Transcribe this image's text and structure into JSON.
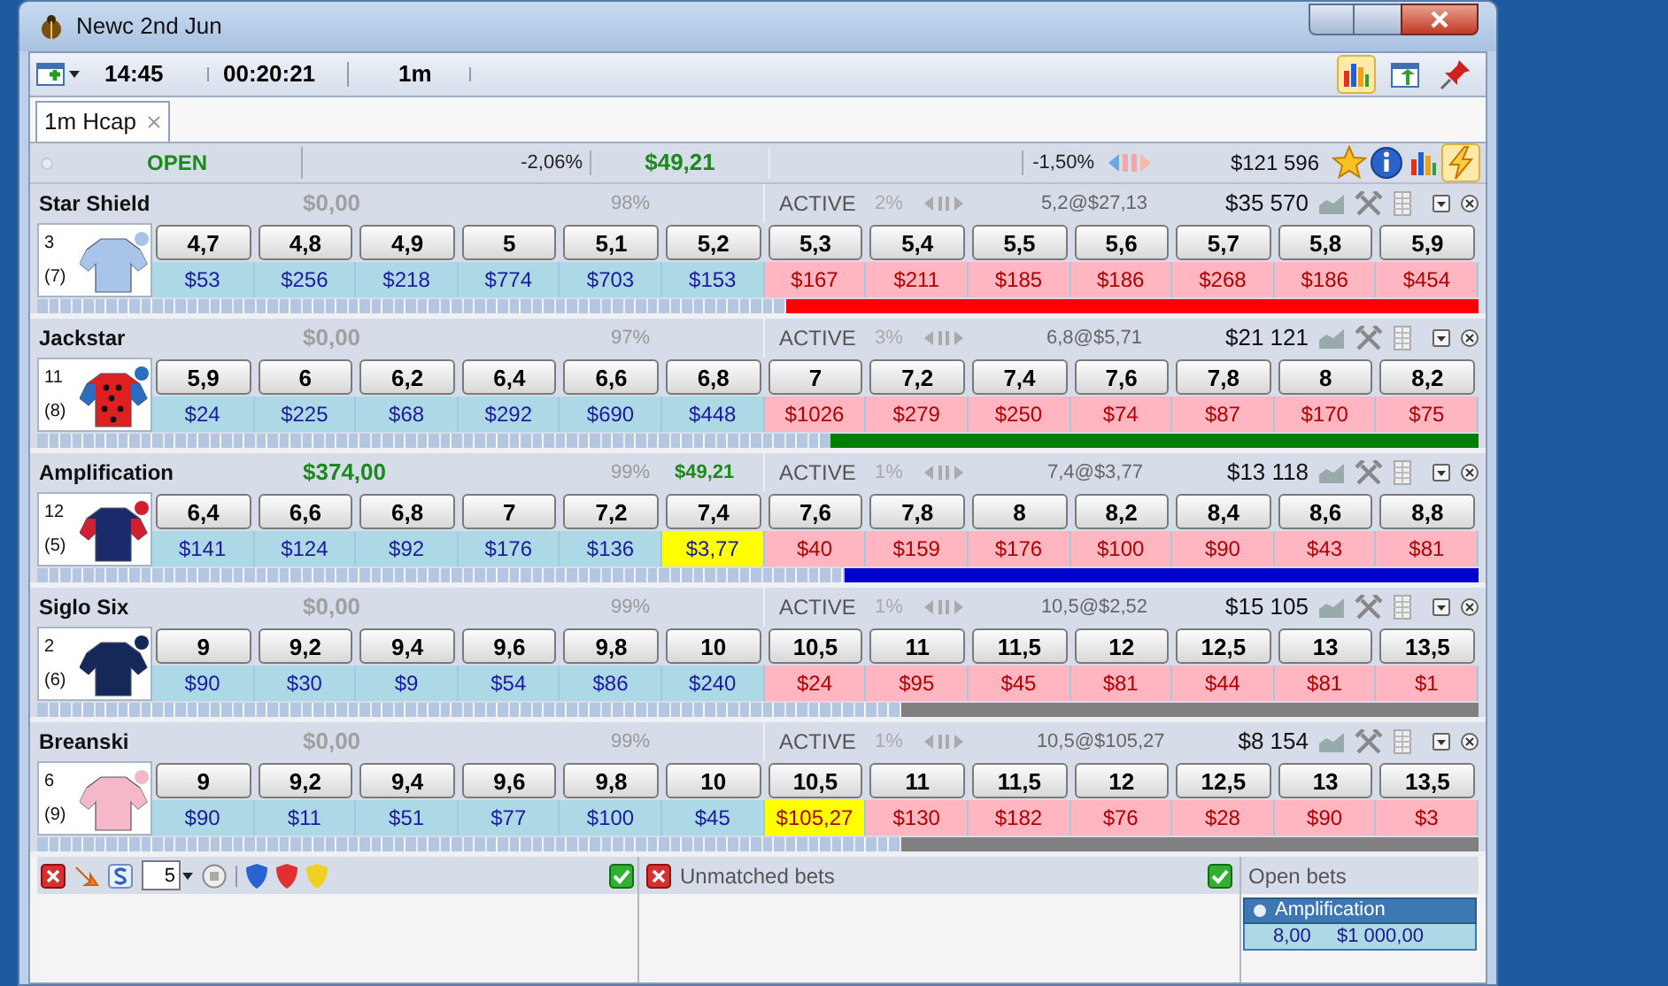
{
  "window": {
    "title": "Newc 2nd Jun"
  },
  "toolbar": {
    "time": "14:45",
    "countdown": "00:20:21",
    "distance": "1m",
    "icons": [
      {
        "kind": "chart",
        "on": true
      },
      {
        "kind": "export",
        "on": false
      },
      {
        "kind": "pin",
        "on": false
      }
    ]
  },
  "tabs": [
    {
      "label": "1m Hcap",
      "selected": true
    }
  ],
  "market": {
    "status": "OPEN",
    "back_percent": "-2,06%",
    "total": "$49,21",
    "lay_percent": "-1,50%",
    "matched": "$121 596",
    "icons": [
      {
        "kind": "star",
        "on": false
      },
      {
        "kind": "info",
        "on": false
      },
      {
        "kind": "chart",
        "on": false
      },
      {
        "kind": "lightning",
        "on": true
      }
    ]
  },
  "runners": [
    {
      "name": "Star Shield",
      "number": "3",
      "draw": "(7)",
      "pl": "$0,00",
      "in_profit": false,
      "percent": "98%",
      "status": "ACTIVE",
      "percent_2": "2%",
      "last_traded": "5,2@$27,13",
      "matched": "$35 570",
      "silk": {
        "color": "#a8c4e8",
        "sleeves": {
          "color": "#a8c4e8"
        },
        "spots": false
      },
      "bar": {
        "level": 0.48,
        "color": "#ff0000"
      },
      "back": [
        {
          "price": "4,7",
          "amount": "$53",
          "highlighted": false
        },
        {
          "price": "4,8",
          "amount": "$256",
          "highlighted": false
        },
        {
          "price": "4,9",
          "amount": "$218",
          "highlighted": false
        },
        {
          "price": "5",
          "amount": "$774",
          "highlighted": false
        },
        {
          "price": "5,1",
          "amount": "$703",
          "highlighted": false
        },
        {
          "price": "5,2",
          "amount": "$153",
          "highlighted": false
        }
      ],
      "lay": [
        {
          "price": "5,3",
          "amount": "$167",
          "highlighted": false
        },
        {
          "price": "5,4",
          "amount": "$211",
          "highlighted": false
        },
        {
          "price": "5,5",
          "amount": "$185",
          "highlighted": false
        },
        {
          "price": "5,6",
          "amount": "$186",
          "highlighted": false
        },
        {
          "price": "5,7",
          "amount": "$268",
          "highlighted": false
        },
        {
          "price": "5,8",
          "amount": "$186",
          "highlighted": false
        },
        {
          "price": "5,9",
          "amount": "$454",
          "highlighted": false
        }
      ]
    },
    {
      "name": "Jackstar",
      "number": "11",
      "draw": "(8)",
      "pl": "$0,00",
      "in_profit": false,
      "percent": "97%",
      "status": "ACTIVE",
      "percent_2": "3%",
      "last_traded": "6,8@$5,71",
      "matched": "$21 121",
      "silk": {
        "color": "#e02020",
        "sleeves": {
          "color": "#2a6cc0"
        },
        "spots": true
      },
      "bar": {
        "level": 0.45,
        "color": "#008000"
      },
      "back": [
        {
          "price": "5,9",
          "amount": "$24",
          "highlighted": false
        },
        {
          "price": "6",
          "amount": "$225",
          "highlighted": false
        },
        {
          "price": "6,2",
          "amount": "$68",
          "highlighted": false
        },
        {
          "price": "6,4",
          "amount": "$292",
          "highlighted": false
        },
        {
          "price": "6,6",
          "amount": "$690",
          "highlighted": false
        },
        {
          "price": "6,8",
          "amount": "$448",
          "highlighted": false
        }
      ],
      "lay": [
        {
          "price": "7",
          "amount": "$1026",
          "highlighted": false
        },
        {
          "price": "7,2",
          "amount": "$279",
          "highlighted": false
        },
        {
          "price": "7,4",
          "amount": "$250",
          "highlighted": false
        },
        {
          "price": "7,6",
          "amount": "$74",
          "highlighted": false
        },
        {
          "price": "7,8",
          "amount": "$87",
          "highlighted": false
        },
        {
          "price": "8",
          "amount": "$170",
          "highlighted": false
        },
        {
          "price": "8,2",
          "amount": "$75",
          "highlighted": false
        }
      ]
    },
    {
      "name": "Amplification",
      "number": "12",
      "draw": "(5)",
      "pl": "$374,00",
      "in_profit": true,
      "percent": "99%",
      "hedge": "$49,21",
      "status": "ACTIVE",
      "percent_2": "1%",
      "last_traded": "7,4@$3,77",
      "matched": "$13 118",
      "silk": {
        "color": "#1a2a6a",
        "sleeves": {
          "color": "#d02030"
        },
        "spots": false
      },
      "bar": {
        "level": 0.44,
        "color": "#0000cc"
      },
      "back": [
        {
          "price": "6,4",
          "amount": "$141",
          "highlighted": false
        },
        {
          "price": "6,6",
          "amount": "$124",
          "highlighted": false
        },
        {
          "price": "6,8",
          "amount": "$92",
          "highlighted": false
        },
        {
          "price": "7",
          "amount": "$176",
          "highlighted": false
        },
        {
          "price": "7,2",
          "amount": "$136",
          "highlighted": false
        },
        {
          "price": "7,4",
          "amount": "$3,77",
          "highlighted": true
        }
      ],
      "lay": [
        {
          "price": "7,6",
          "amount": "$40",
          "highlighted": false
        },
        {
          "price": "7,8",
          "amount": "$159",
          "highlighted": false
        },
        {
          "price": "8",
          "amount": "$176",
          "highlighted": false
        },
        {
          "price": "8,2",
          "amount": "$100",
          "highlighted": false
        },
        {
          "price": "8,4",
          "amount": "$90",
          "highlighted": false
        },
        {
          "price": "8,6",
          "amount": "$43",
          "highlighted": false
        },
        {
          "price": "8,8",
          "amount": "$81",
          "highlighted": false
        }
      ]
    },
    {
      "name": "Siglo Six",
      "number": "2",
      "draw": "(6)",
      "pl": "$0,00",
      "in_profit": false,
      "percent": "99%",
      "status": "ACTIVE",
      "percent_2": "1%",
      "last_traded": "10,5@$2,52",
      "matched": "$15 105",
      "silk": {
        "color": "#14285a",
        "sleeves": {
          "color": "#14285a"
        },
        "spots": false
      },
      "bar": {
        "level": 0.4,
        "color": "#808080"
      },
      "back": [
        {
          "price": "9",
          "amount": "$90",
          "highlighted": false
        },
        {
          "price": "9,2",
          "amount": "$30",
          "highlighted": false
        },
        {
          "price": "9,4",
          "amount": "$9",
          "highlighted": false
        },
        {
          "price": "9,6",
          "amount": "$54",
          "highlighted": false
        },
        {
          "price": "9,8",
          "amount": "$86",
          "highlighted": false
        },
        {
          "price": "10",
          "amount": "$240",
          "highlighted": false
        }
      ],
      "lay": [
        {
          "price": "10,5",
          "amount": "$24",
          "highlighted": false
        },
        {
          "price": "11",
          "amount": "$95",
          "highlighted": false
        },
        {
          "price": "11,5",
          "amount": "$45",
          "highlighted": false
        },
        {
          "price": "12",
          "amount": "$81",
          "highlighted": false
        },
        {
          "price": "12,5",
          "amount": "$44",
          "highlighted": false
        },
        {
          "price": "13",
          "amount": "$81",
          "highlighted": false
        },
        {
          "price": "13,5",
          "amount": "$1",
          "highlighted": false
        }
      ]
    },
    {
      "name": "Breanski",
      "number": "6",
      "draw": "(9)",
      "pl": "$0,00",
      "in_profit": false,
      "percent": "99%",
      "status": "ACTIVE",
      "percent_2": "1%",
      "last_traded": "10,5@$105,27",
      "matched": "$8 154",
      "silk": {
        "color": "#f4b8c8",
        "sleeves": {
          "color": "#f4b8c8"
        },
        "spots": false
      },
      "bar": {
        "level": 0.4,
        "color": "#808080"
      },
      "back": [
        {
          "price": "9",
          "amount": "$90",
          "highlighted": false
        },
        {
          "price": "9,2",
          "amount": "$11",
          "highlighted": false
        },
        {
          "price": "9,4",
          "amount": "$51",
          "highlighted": false
        },
        {
          "price": "9,6",
          "amount": "$77",
          "highlighted": false
        },
        {
          "price": "9,8",
          "amount": "$100",
          "highlighted": false
        },
        {
          "price": "10",
          "amount": "$45",
          "highlighted": false
        }
      ],
      "lay": [
        {
          "price": "10,5",
          "amount": "$105,27",
          "highlighted": true
        },
        {
          "price": "11",
          "amount": "$130",
          "highlighted": false
        },
        {
          "price": "11,5",
          "amount": "$182",
          "highlighted": false
        },
        {
          "price": "12",
          "amount": "$76",
          "highlighted": false
        },
        {
          "price": "12,5",
          "amount": "$28",
          "highlighted": false
        },
        {
          "price": "13",
          "amount": "$90",
          "highlighted": false
        },
        {
          "price": "13,5",
          "amount": "$3",
          "highlighted": false
        }
      ]
    }
  ],
  "bet_panel": {
    "stake": "5"
  },
  "unmatched_bets": {
    "title": "Unmatched bets"
  },
  "open_bets": {
    "title": "Open bets",
    "bets": [
      {
        "runner": "Amplification",
        "price": "8,00",
        "stake": "$1 000,00"
      }
    ]
  }
}
